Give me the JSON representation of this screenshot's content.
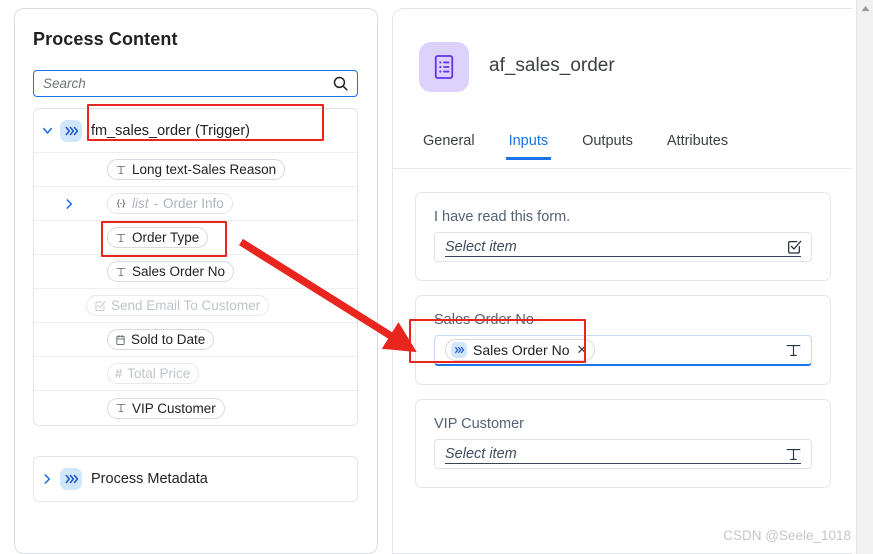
{
  "left_panel": {
    "title": "Process Content",
    "search": {
      "placeholder": "Search",
      "value": "",
      "icon": "search-icon"
    },
    "tree": [
      {
        "id": "root",
        "label": "fm_sales_order (Trigger)",
        "icon": "chevrons-right-icon",
        "caret": "chevron-down-icon",
        "expanded": true,
        "highlighted": true
      },
      {
        "id": "long-text-sales-reason",
        "label": "Long text-Sales Reason",
        "glyph": "T",
        "glyph_name": "text-type-icon",
        "dim": false
      },
      {
        "id": "list-order-info",
        "label": "Order Info",
        "keyword": "list",
        "separator": "-",
        "glyph": "{·}",
        "glyph_name": "object-braces-icon",
        "caret": "chevron-right-icon",
        "dim": true
      },
      {
        "id": "order-type",
        "label": "Order Type",
        "glyph": "T",
        "glyph_name": "text-type-icon",
        "dim": false,
        "highlighted": true
      },
      {
        "id": "sales-order-no",
        "label": "Sales Order No",
        "glyph": "T",
        "glyph_name": "text-type-icon",
        "dim": false
      },
      {
        "id": "send-email-to-customer",
        "label": "Send Email To Customer",
        "glyph": "☑",
        "glyph_name": "checkbox-checked-icon",
        "dim": true
      },
      {
        "id": "sold-to-date",
        "label": "Sold to Date",
        "glyph": "Ὄ5",
        "glyph_name": "calendar-icon",
        "dim": false
      },
      {
        "id": "total-price",
        "label": "Total Price",
        "glyph": "#",
        "glyph_name": "number-hash-icon",
        "dim": true
      },
      {
        "id": "vip-customer",
        "label": "VIP Customer",
        "glyph": "T",
        "glyph_name": "text-type-icon",
        "dim": false
      }
    ],
    "metadata_node": {
      "label": "Process Metadata",
      "icon": "chevrons-right-icon",
      "caret": "chevron-right-icon",
      "expanded": false
    }
  },
  "right_panel": {
    "app_icon": "form-list-icon",
    "title": "af_sales_order",
    "more_button": "•••",
    "close_button": "✕",
    "tabs": [
      {
        "label": "General",
        "active": false
      },
      {
        "label": "Inputs",
        "active": true
      },
      {
        "label": "Outputs",
        "active": false
      },
      {
        "label": "Attributes",
        "active": false
      }
    ],
    "fields": [
      {
        "id": "i-have-read-this-form",
        "label": "I have read this form.",
        "placeholder": "Select item",
        "value": "",
        "trailing_icon": "checkbox-checked-icon",
        "focused": false,
        "token": null
      },
      {
        "id": "sales-order-no",
        "label": "Sales Order No",
        "placeholder": "",
        "value": "Sales Order No",
        "trailing_icon": "text-type-icon",
        "focused": true,
        "token": {
          "label": "Sales Order No",
          "icon": "chevrons-right-icon",
          "remove": "✕"
        }
      },
      {
        "id": "vip-customer",
        "label": "VIP Customer",
        "placeholder": "Select item",
        "value": "",
        "trailing_icon": "text-type-icon",
        "focused": false,
        "token": null
      }
    ]
  },
  "annotations": {
    "highlight_color": "#e8261d",
    "arrow_color": "#e8261d",
    "boxes": [
      {
        "name": "highlight-box-trigger-node"
      },
      {
        "name": "highlight-box-order-type"
      },
      {
        "name": "highlight-box-sales-order-token"
      }
    ]
  },
  "watermark": "CSDN @Seele_1018",
  "colors": {
    "accent_blue": "#1a73e8",
    "icon_bg_blue": "#cfe6fb",
    "app_icon_bg": "#ddd2fb",
    "app_icon_fg": "#6633ee",
    "highlight_red": "#e8261d",
    "panel_border": "#e3e5e9"
  }
}
